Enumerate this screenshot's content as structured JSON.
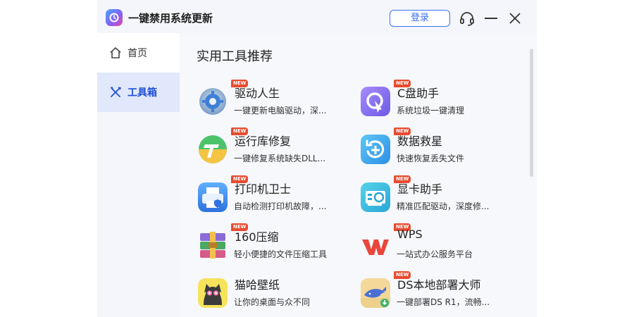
{
  "app": {
    "title": "一键禁用系统更新",
    "login_label": "登录"
  },
  "sidebar": {
    "items": [
      {
        "label": "首页"
      },
      {
        "label": "工具箱"
      }
    ]
  },
  "content": {
    "section_title": "实用工具推荐"
  },
  "tools": [
    {
      "name": "驱动人生",
      "desc": "一键更新电脑驱动，深...",
      "badge": "NEW",
      "icon": "gear-icon"
    },
    {
      "name": "C盘助手",
      "desc": "系统垃圾一键清理",
      "badge": "NEW",
      "icon": "cursor-icon"
    },
    {
      "name": "运行库修复",
      "desc": "一键修复系统缺失DLL...",
      "badge": "NEW",
      "icon": "runtime-icon"
    },
    {
      "name": "数据救星",
      "desc": "快速恢复丢失文件",
      "badge": "NEW",
      "icon": "restore-icon"
    },
    {
      "name": "打印机卫士",
      "desc": "自动检测打印机故障，...",
      "badge": "NEW",
      "icon": "printer-icon"
    },
    {
      "name": "显卡助手",
      "desc": "精准匹配驱动，深度修...",
      "badge": "NEW",
      "icon": "gpu-icon"
    },
    {
      "name": "160压缩",
      "desc": "轻小便捷的文件压缩工具",
      "badge": "NEW",
      "icon": "archive-icon"
    },
    {
      "name": "WPS",
      "desc": "一站式办公服务平台",
      "badge": "NEW",
      "icon": "wps-icon"
    },
    {
      "name": "猫哈壁纸",
      "desc": "让你的桌面与众不同",
      "badge": "",
      "icon": "cat-icon"
    },
    {
      "name": "DS本地部署大师",
      "desc": "一键部署DS R1，流畅...",
      "badge": "NEW",
      "icon": "whale-icon"
    }
  ]
}
